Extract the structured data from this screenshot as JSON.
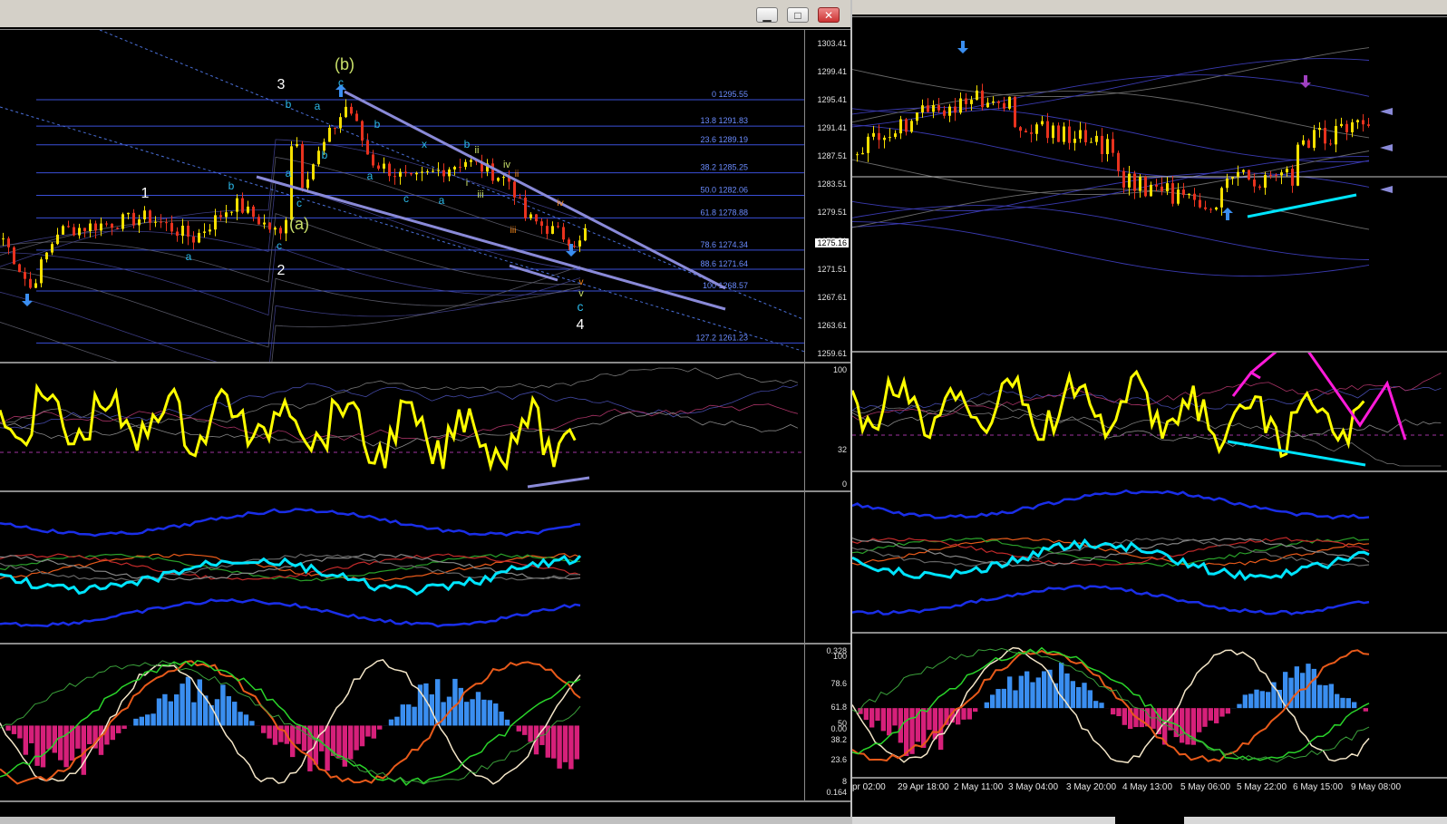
{
  "window_buttons": {
    "minimize": "▁",
    "maximize": "□",
    "close": "✕"
  },
  "left": {
    "main_pane": {
      "price_ticks": [
        "1303.41",
        "1299.41",
        "1295.41",
        "1291.41",
        "1287.51",
        "1283.51",
        "1279.51",
        "1275.51",
        "1271.51",
        "1267.61",
        "1263.61",
        "1259.61"
      ],
      "current_price": "1275.16",
      "fib_levels": [
        {
          "label": "0 1295.55",
          "price": 1295.55
        },
        {
          "label": "13.8 1291.83",
          "price": 1291.83
        },
        {
          "label": "23.6 1289.19",
          "price": 1289.19
        },
        {
          "label": "38.2 1285.25",
          "price": 1285.25
        },
        {
          "label": "50.0 1282.06",
          "price": 1282.06
        },
        {
          "label": "61.8 1278.88",
          "price": 1278.88
        },
        {
          "label": "78.6 1274.34",
          "price": 1274.34
        },
        {
          "label": "88.6 1271.64",
          "price": 1271.64
        },
        {
          "label": "100 1268.57",
          "price": 1268.57
        },
        {
          "label": "127.2 1261.23",
          "price": 1261.23
        }
      ],
      "wave_labels": {
        "w1": "1",
        "w2": "2",
        "w3": "3",
        "w4": "4",
        "wa_big": "(a)",
        "wb_big": "(b)",
        "a": "a",
        "b": "b",
        "c": "c",
        "x": "x",
        "i": "i",
        "ii": "ii",
        "iii": "iii",
        "iv": "iv",
        "v": "v"
      }
    },
    "rsi_pane": {
      "ticks": [
        "100",
        "32",
        "0"
      ]
    },
    "stoch_pane": {
      "ticks": [
        "100",
        "78.6",
        "61.8",
        "50",
        "38.2",
        "23.6",
        "8",
        "0.164",
        "0.00",
        "0.328"
      ]
    }
  },
  "right": {
    "time_labels": [
      "pr 02:00",
      "29 Apr 18:00",
      "2 May 11:00",
      "3 May 04:00",
      "3 May 20:00",
      "4 May 13:00",
      "5 May 06:00",
      "5 May 22:00",
      "6 May 15:00",
      "9 May 08:00"
    ]
  },
  "colors": {
    "grid_blue": "#3a4fd8",
    "candle_up": "#f5e000",
    "candle_down": "#e8321e",
    "rsi": "#ffff00",
    "cyan": "#00e5ff",
    "magenta": "#ff1ad9",
    "arrow_blue": "#3a8ef0",
    "trend": "#8a8ad8",
    "hist_up": "#3a8ef0",
    "hist_down": "#d6207a"
  }
}
